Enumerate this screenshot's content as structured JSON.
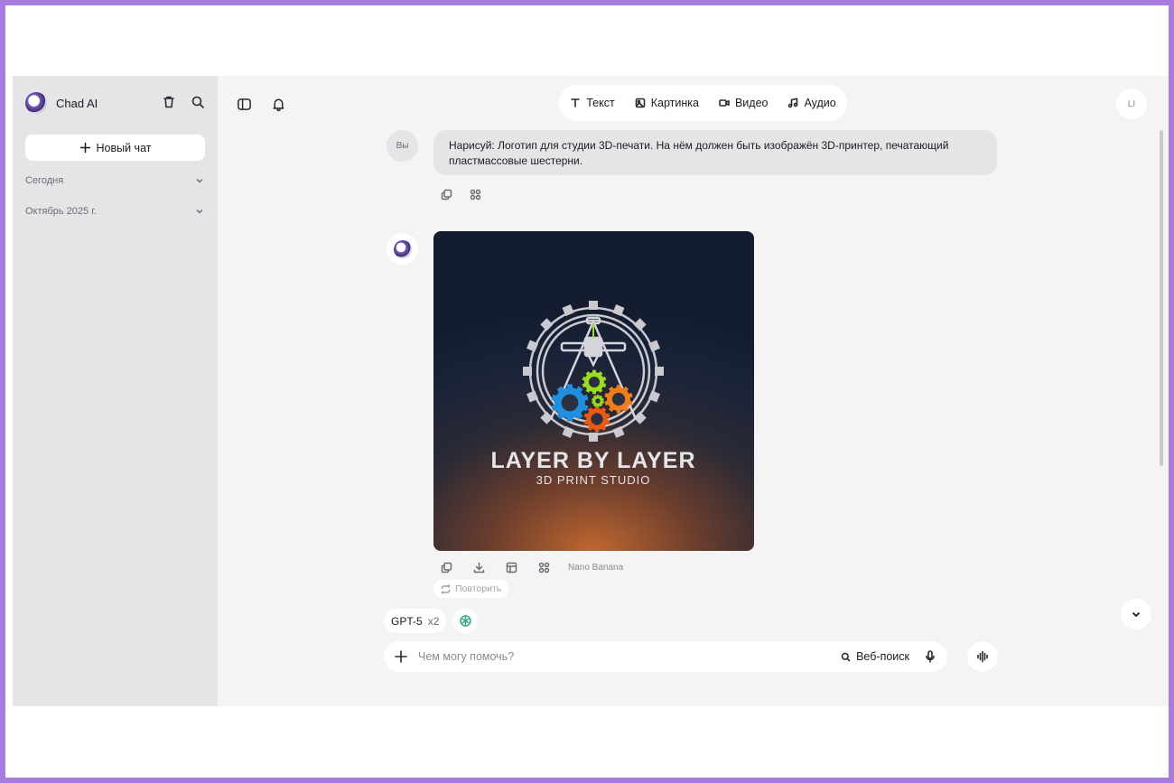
{
  "sidebar": {
    "app_name": "Chad AI",
    "new_chat_label": "Новый чат",
    "sections": [
      {
        "label": "Сегодня"
      },
      {
        "label": "Октябрь 2025 г."
      }
    ]
  },
  "modes": [
    {
      "label": "Текст",
      "icon": "text-icon"
    },
    {
      "label": "Картинка",
      "icon": "image-icon"
    },
    {
      "label": "Видео",
      "icon": "video-icon"
    },
    {
      "label": "Аудио",
      "icon": "music-icon"
    }
  ],
  "user_avatar_initials": "LI",
  "conversation": {
    "user_label": "Вы",
    "user_message": "Нарисуй: Логотип для студии 3D-печати. На нём должен быть изображён 3D-принтер, печатающий пластмассовые шестерни.",
    "image": {
      "title": "LAYER BY LAYER",
      "subtitle": "3D PRINT STUDIO",
      "gear_colors": [
        "#9bdc1f",
        "#1f8fe0",
        "#f07d1a",
        "#ea5a12"
      ]
    },
    "model_tag": "Nano Banana",
    "retry_label": "Повторить"
  },
  "model_selector": {
    "name": "GPT-5",
    "multiplier": "x2"
  },
  "composer": {
    "placeholder": "Чем могу помочь?",
    "web_search_label": "Веб-поиск"
  }
}
